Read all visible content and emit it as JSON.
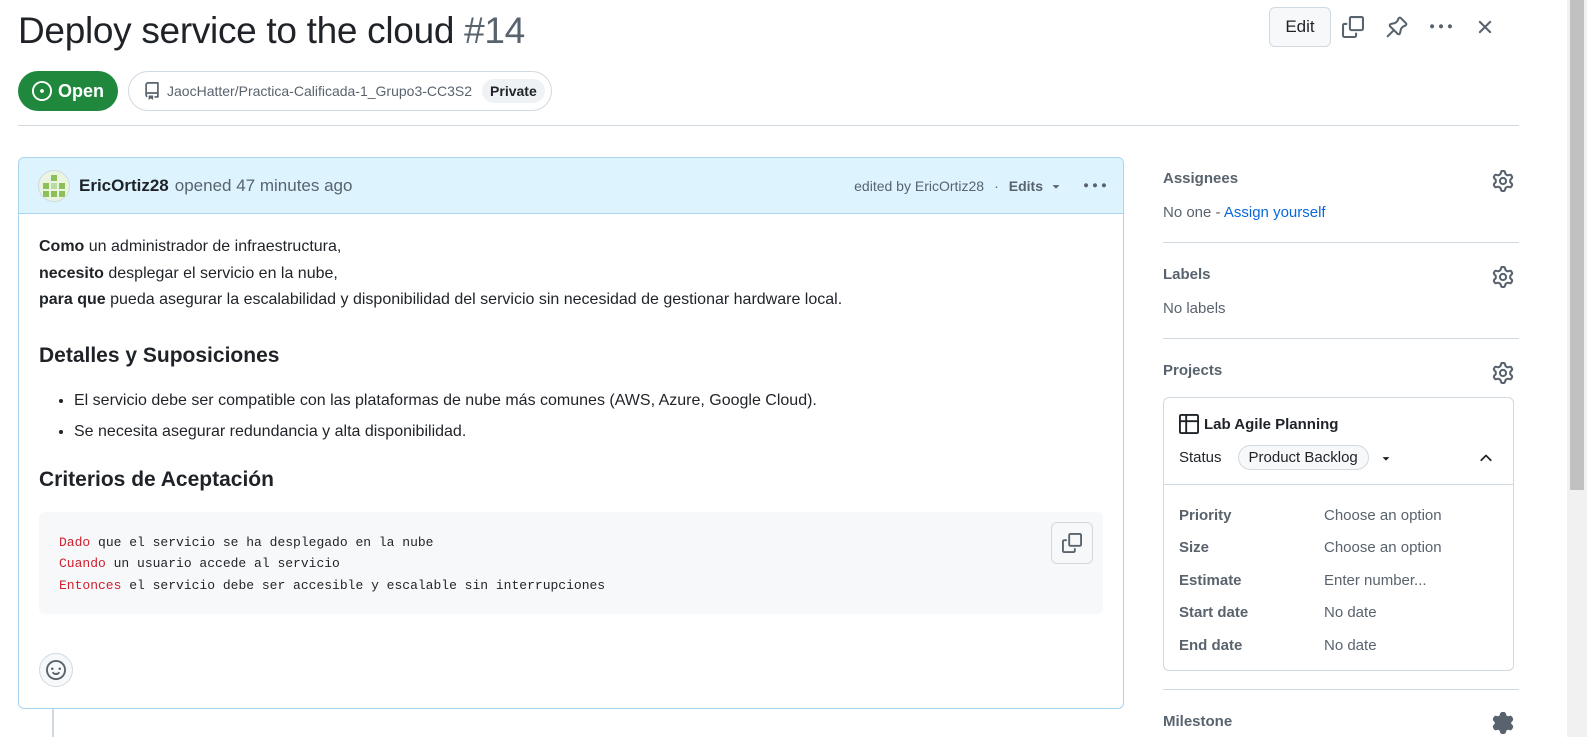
{
  "issue": {
    "title": "Deploy service to the cloud",
    "number": "#14",
    "state": "Open",
    "repo": "JaocHatter/Practica-Calificada-1_Grupo3-CC3S2",
    "visibility": "Private"
  },
  "header": {
    "edit_label": "Edit"
  },
  "comment": {
    "author": "EricOrtiz28",
    "opened_text": "opened 47 minutes ago",
    "edited_text": "edited by EricOrtiz28",
    "separator": "·",
    "edits_label": "Edits",
    "story": [
      {
        "bold": "Como",
        "rest": " un administrador de infraestructura,"
      },
      {
        "bold": "necesito",
        "rest": " desplegar el servicio en la nube,"
      },
      {
        "bold": "para que",
        "rest": " pueda asegurar la escalabilidad y disponibilidad del servicio sin necesidad de gestionar hardware local."
      }
    ],
    "section1_title": "Detalles y Suposiciones",
    "bullets": [
      "El servicio debe ser compatible con las plataformas de nube más comunes (AWS, Azure, Google Cloud).",
      "Se necesita asegurar redundancia y alta disponibilidad."
    ],
    "section2_title": "Criterios de Aceptación",
    "code": [
      {
        "kw": "Dado",
        "rest": " que el servicio se ha desplegado en la nube"
      },
      {
        "kw": "Cuando",
        "rest": " un usuario accede al servicio"
      },
      {
        "kw": "Entonces",
        "rest": " el servicio debe ser accesible y escalable sin interrupciones"
      }
    ]
  },
  "sidebar": {
    "assignees_title": "Assignees",
    "assignees_none": "No one - ",
    "assign_yourself": "Assign yourself",
    "labels_title": "Labels",
    "labels_none": "No labels",
    "projects_title": "Projects",
    "project": {
      "name": "Lab Agile Planning",
      "status_label": "Status",
      "status_value": "Product Backlog",
      "fields": [
        {
          "key": "Priority",
          "value": "Choose an option"
        },
        {
          "key": "Size",
          "value": "Choose an option"
        },
        {
          "key": "Estimate",
          "value": "Enter number..."
        },
        {
          "key": "Start date",
          "value": "No date"
        },
        {
          "key": "End date",
          "value": "No date"
        }
      ]
    },
    "milestone_title": "Milestone"
  },
  "colors": {
    "open_green": "#1f883d",
    "comment_header_bg": "#ddf4ff",
    "link_blue": "#0969da",
    "keyword_red": "#cf222e"
  }
}
